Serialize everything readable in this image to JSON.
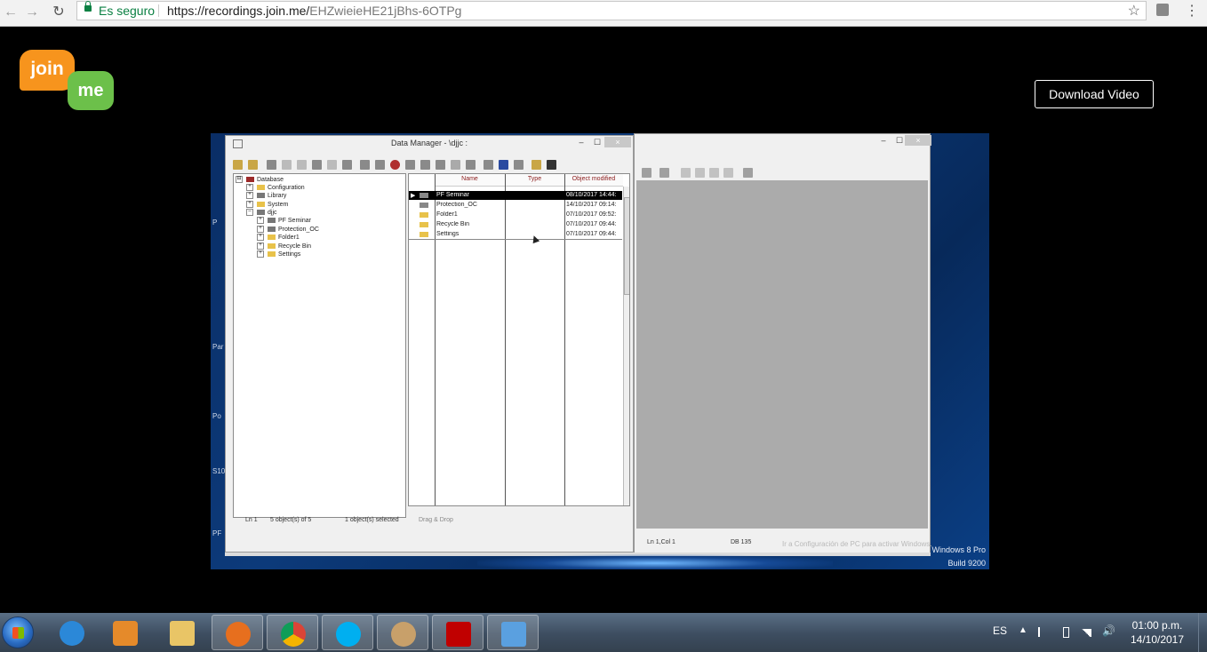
{
  "browser": {
    "secure_label": "Es seguro",
    "url_host": "https://recordings.join.me/",
    "url_path": "EHZwieieHE21jBhs-6OTPg",
    "back": "←",
    "forward": "→",
    "reload": "↻",
    "star": "☆",
    "menu": "⋮"
  },
  "page": {
    "logo_top": "join",
    "logo_bottom": "me",
    "download_label": "Download Video"
  },
  "video": {
    "edge_labels": [
      "P",
      "Par",
      "Po",
      "S10",
      "PF"
    ],
    "os_text": [
      "Windows 8 Pro",
      "Build 9200"
    ],
    "watermark": "Ir a Configuración de PC para activar Windows."
  },
  "data_manager": {
    "title": "Data Manager - \\djjc :",
    "min": "–",
    "max": "☐",
    "close": "×",
    "tree": [
      {
        "label": "Database",
        "exp": "⊟",
        "icon": "db"
      },
      {
        "label": "Configuration",
        "exp": "+",
        "icon": "folder"
      },
      {
        "label": "Library",
        "exp": "+",
        "icon": "lib"
      },
      {
        "label": "System",
        "exp": "+",
        "icon": "folder"
      },
      {
        "label": "djjc",
        "exp": "–",
        "icon": "item"
      },
      {
        "label": "PF Seminar",
        "exp": "+",
        "icon": "item"
      },
      {
        "label": "Protection_OC",
        "exp": "+",
        "icon": "item"
      },
      {
        "label": "Folder1",
        "exp": "+",
        "icon": "folder"
      },
      {
        "label": "Recycle Bin",
        "exp": "+",
        "icon": "folder"
      },
      {
        "label": "Settings",
        "exp": "+",
        "icon": "folder"
      }
    ],
    "columns": [
      "Name",
      "Type",
      "Object modified"
    ],
    "rows": [
      {
        "marker": "▶",
        "name": "PF Seminar",
        "type": "",
        "modified": "08/10/2017 14:44:",
        "selected": true
      },
      {
        "marker": "",
        "name": "Protection_OC",
        "type": "",
        "modified": "14/10/2017 09:14:",
        "selected": false
      },
      {
        "marker": "",
        "name": "Folder1",
        "type": "",
        "modified": "07/10/2017 09:52:",
        "selected": false
      },
      {
        "marker": "",
        "name": "Recycle Bin",
        "type": "",
        "modified": "07/10/2017 09:44:",
        "selected": false
      },
      {
        "marker": "",
        "name": "Settings",
        "type": "",
        "modified": "07/10/2017 09:44:",
        "selected": false
      }
    ],
    "status": {
      "ln": "Ln 1",
      "objects": "5 object(s) of 5",
      "selected": "1 object(s) selected",
      "drag": "Drag & Drop"
    }
  },
  "right_window": {
    "min": "–",
    "max": "☐",
    "close": "×",
    "status_pos": "Ln 1,Col 1",
    "status_db": "DB 135"
  },
  "taskbar": {
    "lang": "ES",
    "time": "01:00 p.m.",
    "date": "14/10/2017",
    "apps": [
      {
        "name": "internet-explorer",
        "color": "#2b88d8"
      },
      {
        "name": "media-player",
        "color": "#e58a2a"
      },
      {
        "name": "file-explorer",
        "color": "#e9c566"
      },
      {
        "name": "firefox",
        "color": "#e76f1e"
      },
      {
        "name": "chrome",
        "color": "#4caf50"
      },
      {
        "name": "skype",
        "color": "#00aff0"
      },
      {
        "name": "paint",
        "color": "#c8a06a"
      },
      {
        "name": "acrobat",
        "color": "#c00000"
      },
      {
        "name": "calculator",
        "color": "#5aa0e0"
      }
    ]
  }
}
